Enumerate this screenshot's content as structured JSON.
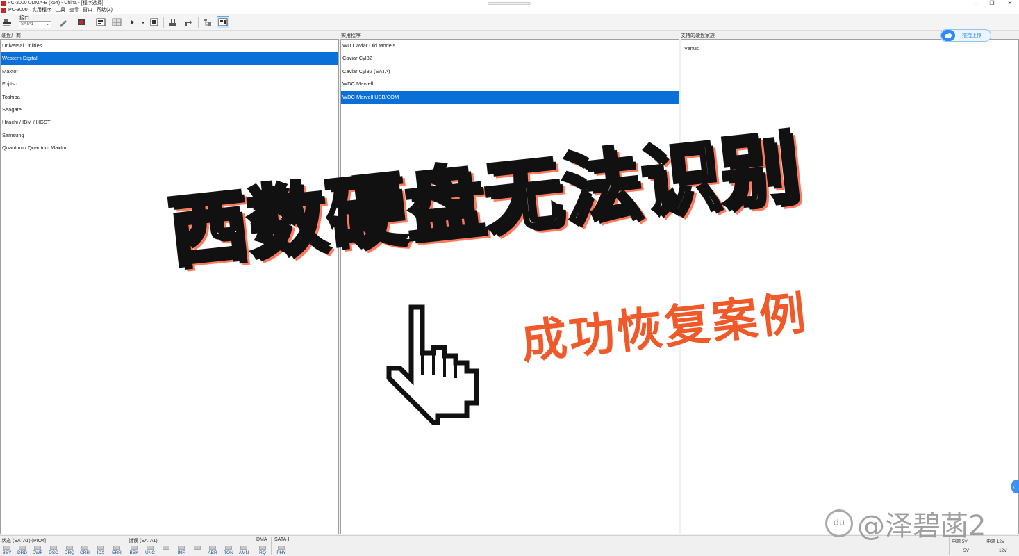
{
  "window": {
    "title": "PC-3000 UDMA-E (x64) - China - [程序选择]"
  },
  "menu": {
    "items": [
      "PC-3000",
      "实用程序",
      "工具",
      "查看",
      "窗口",
      "帮助(Z)"
    ]
  },
  "toolbar": {
    "port_label": "接口",
    "port_value": "SATA1",
    "active_tool": "view-mode"
  },
  "panels": {
    "vendors": {
      "label": "硬盘厂商",
      "items": [
        "Universal Utilities",
        "Western Digital",
        "Maxtor",
        "Fujitsu",
        "Toshiba",
        "Seagate",
        "Hitachi / IBM / HGST",
        "Samsung",
        "Quantum / Quantum Maxtor"
      ],
      "selected_index": 1
    },
    "utilities": {
      "label": "实用程序",
      "items": [
        "WD Caviar Old Models",
        "Caviar Cyl32",
        "Caviar Cyl32 (SATA)",
        "WDC Marvell",
        "WDC Marvell USB/COM"
      ],
      "selected_index": 4
    },
    "families": {
      "label": "支持的硬盘家族",
      "items": [
        "Venus"
      ]
    }
  },
  "status": {
    "state_title": "状态 (SATA1)-[PIO4]",
    "state_leds": [
      "BSY",
      "DRD",
      "DWF",
      "DSC",
      "DRQ",
      "CRR",
      "IDX",
      "ERR"
    ],
    "error_title": "错误 (SATA1)",
    "error_leds": [
      "BBK",
      "UNC",
      "",
      "INF",
      "",
      "ABR",
      "TON",
      "AMN"
    ],
    "dma_title": "DMA",
    "dma_led": "RQ",
    "sata_title": "SATA-II",
    "sata_led": "PHY",
    "power5_title": "电源 5V",
    "power5_value": "5V",
    "power12_title": "电源 12V",
    "power12_value": "12V"
  },
  "overlay": {
    "headline": "西数硬盘无法识别",
    "subtitle": "成功恢复案例",
    "upload_button": "拖拽上传",
    "watermark": "@泽碧菡2",
    "watermark_logo": "du",
    "collapse_glyph": "‹"
  },
  "colors": {
    "selection": "#0a6fd6",
    "subtitle": "#f05a2a",
    "upload_accent": "#2b8af3"
  }
}
